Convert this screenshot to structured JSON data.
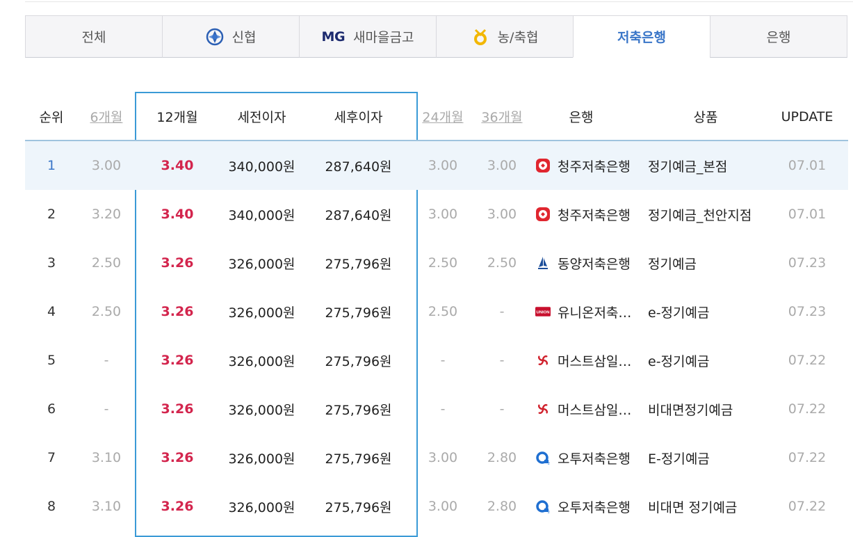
{
  "tabs": [
    {
      "label": "전체",
      "icon": "",
      "active": false
    },
    {
      "label": "신협",
      "icon": "shinhyup-logo-icon",
      "active": false
    },
    {
      "label": "새마을금고",
      "icon": "mg-logo-icon",
      "mg_text": "MG",
      "active": false
    },
    {
      "label": "농/축협",
      "icon": "nonghyup-logo-icon",
      "active": false
    },
    {
      "label": "저축은행",
      "icon": "",
      "active": true
    },
    {
      "label": "은행",
      "icon": "",
      "active": false
    }
  ],
  "headers": {
    "rank": "순위",
    "m6": "6개월",
    "m12": "12개월",
    "pre_tax": "세전이자",
    "post_tax": "세후이자",
    "m24": "24개월",
    "m36": "36개월",
    "bank": "은행",
    "product": "상품",
    "update": "UPDATE"
  },
  "colors": {
    "accent_blue": "#3a76c8",
    "box_border": "#3a9ad6",
    "rate_red": "#d3254d",
    "highlight_row": "#eef5fb"
  },
  "rows": [
    {
      "rank": "1",
      "m6": "3.00",
      "m12": "3.40",
      "pre": "340,000원",
      "post": "287,640원",
      "m24": "3.00",
      "m36": "3.00",
      "bank": "청주저축은행",
      "logo": "cheongju-bank-logo-icon",
      "product": "정기예금_본점",
      "update": "07.01"
    },
    {
      "rank": "2",
      "m6": "3.20",
      "m12": "3.40",
      "pre": "340,000원",
      "post": "287,640원",
      "m24": "3.00",
      "m36": "3.00",
      "bank": "청주저축은행",
      "logo": "cheongju-bank-logo-icon",
      "product": "정기예금_천안지점",
      "update": "07.01"
    },
    {
      "rank": "3",
      "m6": "2.50",
      "m12": "3.26",
      "pre": "326,000원",
      "post": "275,796원",
      "m24": "2.50",
      "m36": "2.50",
      "bank": "동양저축은행",
      "logo": "dongyang-bank-logo-icon",
      "product": "정기예금",
      "update": "07.23"
    },
    {
      "rank": "4",
      "m6": "2.50",
      "m12": "3.26",
      "pre": "326,000원",
      "post": "275,796원",
      "m24": "2.50",
      "m36": "-",
      "bank": "유니온저축…",
      "logo": "union-bank-logo-icon",
      "logo_text": "UNION",
      "product": "e-정기예금",
      "update": "07.23"
    },
    {
      "rank": "5",
      "m6": "-",
      "m12": "3.26",
      "pre": "326,000원",
      "post": "275,796원",
      "m24": "-",
      "m36": "-",
      "bank": "머스트삼일…",
      "logo": "must-samil-bank-logo-icon",
      "product": "e-정기예금",
      "update": "07.22"
    },
    {
      "rank": "6",
      "m6": "-",
      "m12": "3.26",
      "pre": "326,000원",
      "post": "275,796원",
      "m24": "-",
      "m36": "-",
      "bank": "머스트삼일…",
      "logo": "must-samil-bank-logo-icon",
      "product": "비대면정기예금",
      "update": "07.22"
    },
    {
      "rank": "7",
      "m6": "3.10",
      "m12": "3.26",
      "pre": "326,000원",
      "post": "275,796원",
      "m24": "3.00",
      "m36": "2.80",
      "bank": "오투저축은행",
      "logo": "o2-bank-logo-icon",
      "product": "E-정기예금",
      "update": "07.22"
    },
    {
      "rank": "8",
      "m6": "3.10",
      "m12": "3.26",
      "pre": "326,000원",
      "post": "275,796원",
      "m24": "3.00",
      "m36": "2.80",
      "bank": "오투저축은행",
      "logo": "o2-bank-logo-icon",
      "product": "비대면 정기예금",
      "update": "07.22"
    }
  ]
}
